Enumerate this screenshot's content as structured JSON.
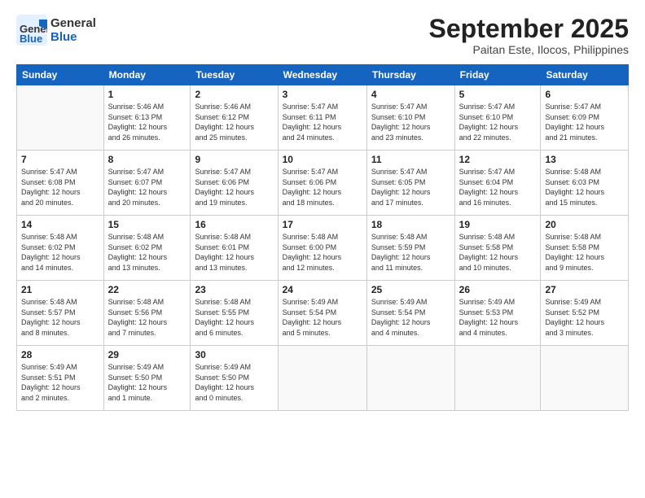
{
  "header": {
    "logo": {
      "line1": "General",
      "line2": "Blue"
    },
    "title": "September 2025",
    "subtitle": "Paitan Este, Ilocos, Philippines"
  },
  "weekdays": [
    "Sunday",
    "Monday",
    "Tuesday",
    "Wednesday",
    "Thursday",
    "Friday",
    "Saturday"
  ],
  "weeks": [
    [
      {
        "day": "",
        "info": ""
      },
      {
        "day": "1",
        "info": "Sunrise: 5:46 AM\nSunset: 6:13 PM\nDaylight: 12 hours\nand 26 minutes."
      },
      {
        "day": "2",
        "info": "Sunrise: 5:46 AM\nSunset: 6:12 PM\nDaylight: 12 hours\nand 25 minutes."
      },
      {
        "day": "3",
        "info": "Sunrise: 5:47 AM\nSunset: 6:11 PM\nDaylight: 12 hours\nand 24 minutes."
      },
      {
        "day": "4",
        "info": "Sunrise: 5:47 AM\nSunset: 6:10 PM\nDaylight: 12 hours\nand 23 minutes."
      },
      {
        "day": "5",
        "info": "Sunrise: 5:47 AM\nSunset: 6:10 PM\nDaylight: 12 hours\nand 22 minutes."
      },
      {
        "day": "6",
        "info": "Sunrise: 5:47 AM\nSunset: 6:09 PM\nDaylight: 12 hours\nand 21 minutes."
      }
    ],
    [
      {
        "day": "7",
        "info": "Sunrise: 5:47 AM\nSunset: 6:08 PM\nDaylight: 12 hours\nand 20 minutes."
      },
      {
        "day": "8",
        "info": "Sunrise: 5:47 AM\nSunset: 6:07 PM\nDaylight: 12 hours\nand 20 minutes."
      },
      {
        "day": "9",
        "info": "Sunrise: 5:47 AM\nSunset: 6:06 PM\nDaylight: 12 hours\nand 19 minutes."
      },
      {
        "day": "10",
        "info": "Sunrise: 5:47 AM\nSunset: 6:06 PM\nDaylight: 12 hours\nand 18 minutes."
      },
      {
        "day": "11",
        "info": "Sunrise: 5:47 AM\nSunset: 6:05 PM\nDaylight: 12 hours\nand 17 minutes."
      },
      {
        "day": "12",
        "info": "Sunrise: 5:47 AM\nSunset: 6:04 PM\nDaylight: 12 hours\nand 16 minutes."
      },
      {
        "day": "13",
        "info": "Sunrise: 5:48 AM\nSunset: 6:03 PM\nDaylight: 12 hours\nand 15 minutes."
      }
    ],
    [
      {
        "day": "14",
        "info": "Sunrise: 5:48 AM\nSunset: 6:02 PM\nDaylight: 12 hours\nand 14 minutes."
      },
      {
        "day": "15",
        "info": "Sunrise: 5:48 AM\nSunset: 6:02 PM\nDaylight: 12 hours\nand 13 minutes."
      },
      {
        "day": "16",
        "info": "Sunrise: 5:48 AM\nSunset: 6:01 PM\nDaylight: 12 hours\nand 13 minutes."
      },
      {
        "day": "17",
        "info": "Sunrise: 5:48 AM\nSunset: 6:00 PM\nDaylight: 12 hours\nand 12 minutes."
      },
      {
        "day": "18",
        "info": "Sunrise: 5:48 AM\nSunset: 5:59 PM\nDaylight: 12 hours\nand 11 minutes."
      },
      {
        "day": "19",
        "info": "Sunrise: 5:48 AM\nSunset: 5:58 PM\nDaylight: 12 hours\nand 10 minutes."
      },
      {
        "day": "20",
        "info": "Sunrise: 5:48 AM\nSunset: 5:58 PM\nDaylight: 12 hours\nand 9 minutes."
      }
    ],
    [
      {
        "day": "21",
        "info": "Sunrise: 5:48 AM\nSunset: 5:57 PM\nDaylight: 12 hours\nand 8 minutes."
      },
      {
        "day": "22",
        "info": "Sunrise: 5:48 AM\nSunset: 5:56 PM\nDaylight: 12 hours\nand 7 minutes."
      },
      {
        "day": "23",
        "info": "Sunrise: 5:48 AM\nSunset: 5:55 PM\nDaylight: 12 hours\nand 6 minutes."
      },
      {
        "day": "24",
        "info": "Sunrise: 5:49 AM\nSunset: 5:54 PM\nDaylight: 12 hours\nand 5 minutes."
      },
      {
        "day": "25",
        "info": "Sunrise: 5:49 AM\nSunset: 5:54 PM\nDaylight: 12 hours\nand 4 minutes."
      },
      {
        "day": "26",
        "info": "Sunrise: 5:49 AM\nSunset: 5:53 PM\nDaylight: 12 hours\nand 4 minutes."
      },
      {
        "day": "27",
        "info": "Sunrise: 5:49 AM\nSunset: 5:52 PM\nDaylight: 12 hours\nand 3 minutes."
      }
    ],
    [
      {
        "day": "28",
        "info": "Sunrise: 5:49 AM\nSunset: 5:51 PM\nDaylight: 12 hours\nand 2 minutes."
      },
      {
        "day": "29",
        "info": "Sunrise: 5:49 AM\nSunset: 5:50 PM\nDaylight: 12 hours\nand 1 minute."
      },
      {
        "day": "30",
        "info": "Sunrise: 5:49 AM\nSunset: 5:50 PM\nDaylight: 12 hours\nand 0 minutes."
      },
      {
        "day": "",
        "info": ""
      },
      {
        "day": "",
        "info": ""
      },
      {
        "day": "",
        "info": ""
      },
      {
        "day": "",
        "info": ""
      }
    ]
  ]
}
